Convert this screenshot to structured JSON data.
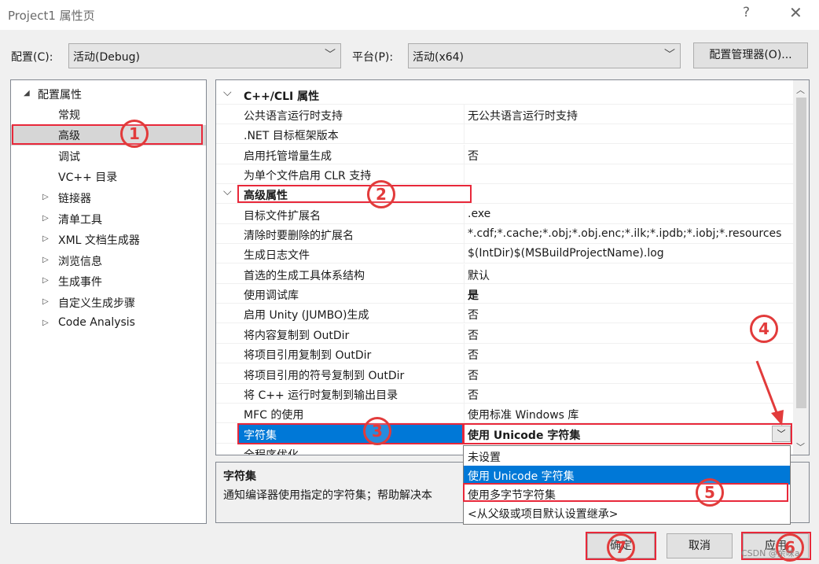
{
  "window": {
    "title": "Project1 属性页",
    "help_icon": "?",
    "close_icon": "✕"
  },
  "config_bar": {
    "config_label": "配置(C):",
    "config_value": "活动(Debug)",
    "platform_label": "平台(P):",
    "platform_value": "活动(x64)",
    "manager_button": "配置管理器(O)..."
  },
  "tree": {
    "root": "配置属性",
    "items": [
      "常规",
      "高级",
      "调试",
      "VC++ 目录"
    ],
    "groups": [
      "链接器",
      "清单工具",
      "XML 文档生成器",
      "浏览信息",
      "生成事件",
      "自定义生成步骤",
      "Code Analysis"
    ],
    "selected": "高级"
  },
  "grid": {
    "cat1": "C++/CLI 属性",
    "cat1_rows": [
      {
        "name": "公共语言运行时支持",
        "value": "无公共语言运行时支持"
      },
      {
        "name": ".NET 目标框架版本",
        "value": ""
      },
      {
        "name": "启用托管增量生成",
        "value": "否"
      },
      {
        "name": "为单个文件启用 CLR 支持",
        "value": ""
      }
    ],
    "cat2": "高级属性",
    "cat2_rows": [
      {
        "name": "目标文件扩展名",
        "value": ".exe"
      },
      {
        "name": "清除时要删除的扩展名",
        "value": "*.cdf;*.cache;*.obj;*.obj.enc;*.ilk;*.ipdb;*.iobj;*.resources"
      },
      {
        "name": "生成日志文件",
        "value": "$(IntDir)$(MSBuildProjectName).log"
      },
      {
        "name": "首选的生成工具体系结构",
        "value": "默认"
      },
      {
        "name": "使用调试库",
        "value": "是"
      },
      {
        "name": "启用 Unity (JUMBO)生成",
        "value": "否"
      },
      {
        "name": "将内容复制到 OutDir",
        "value": "否"
      },
      {
        "name": "将项目引用复制到 OutDir",
        "value": "否"
      },
      {
        "name": "将项目引用的符号复制到 OutDir",
        "value": "否"
      },
      {
        "name": "将 C++ 运行时复制到输出目录",
        "value": "否"
      },
      {
        "name": "MFC 的使用",
        "value": "使用标准 Windows 库"
      }
    ],
    "selected_row": {
      "name": "字符集",
      "value": "使用 Unicode 字符集"
    },
    "partial_row": "全程序优化"
  },
  "description": {
    "title": "字符集",
    "text": "通知编译器使用指定的字符集；帮助解决本"
  },
  "dropdown": {
    "options": [
      "未设置",
      "使用 Unicode 字符集",
      "使用多字节字符集",
      "<从父级或项目默认设置继承>"
    ],
    "highlighted": "使用 Unicode 字符集"
  },
  "buttons": {
    "ok": "确定",
    "cancel": "取消",
    "apply": "应用"
  },
  "annotations": [
    "1",
    "2",
    "3",
    "4",
    "5",
    "6",
    "7"
  ],
  "watermark": "CSDN @余味a",
  "colors": {
    "selection": "#0078d7",
    "annotation": "#e23b3b"
  }
}
